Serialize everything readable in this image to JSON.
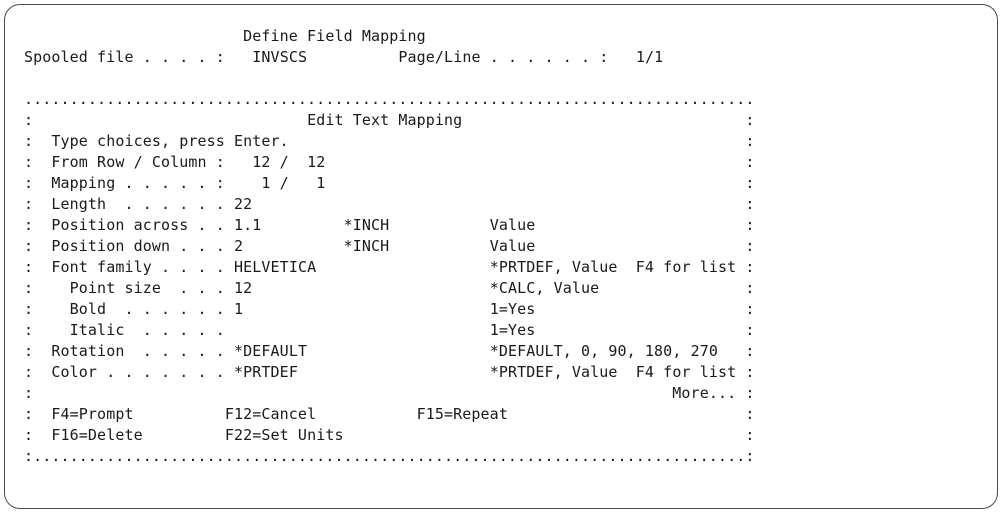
{
  "screen": {
    "title": "Define Field Mapping",
    "spooled_file_label": "Spooled file . . . . :",
    "spooled_file_value": "INVSCS",
    "page_line_label": "Page/Line . . . . . . :",
    "page_line_value": "1/1"
  },
  "window": {
    "border_top": "................................................................................",
    "border_bottom": ":..............................................................................:",
    "title": "Edit Text Mapping",
    "instruction": "Type choices, press Enter.",
    "rows": [
      {
        "label": "From Row / Column :",
        "value": "  12 /  12",
        "hint": ""
      },
      {
        "label": "Mapping . . . . . :",
        "value": "   1 /   1",
        "hint": ""
      },
      {
        "label": "Length  . . . . . .",
        "value": "22",
        "hint": ""
      },
      {
        "label": "Position across . .",
        "value": "1.1",
        "unit": "*INCH",
        "hint": "Value"
      },
      {
        "label": "Position down . . .",
        "value": "2",
        "unit": "*INCH",
        "hint": "Value"
      },
      {
        "label": "Font family . . . .",
        "value": "HELVETICA",
        "hint": "*PRTDEF, Value  F4 for list"
      },
      {
        "label": "  Point size  . . .",
        "value": "12",
        "hint": "*CALC, Value"
      },
      {
        "label": "  Bold  . . . . . .",
        "value": "1",
        "hint": "1=Yes"
      },
      {
        "label": "  Italic  . . . . .",
        "value": "",
        "hint": "1=Yes"
      },
      {
        "label": "Rotation  . . . . .",
        "value": "*DEFAULT",
        "hint": "*DEFAULT, 0, 90, 180, 270"
      },
      {
        "label": "Color . . . . . . .",
        "value": "*PRTDEF",
        "hint": "*PRTDEF, Value  F4 for list"
      }
    ],
    "more": "More...",
    "fkeys_row1": [
      "F4=Prompt",
      "F12=Cancel",
      "F15=Repeat"
    ],
    "fkeys_row2": [
      "F16=Delete",
      "F22=Set Units"
    ]
  }
}
